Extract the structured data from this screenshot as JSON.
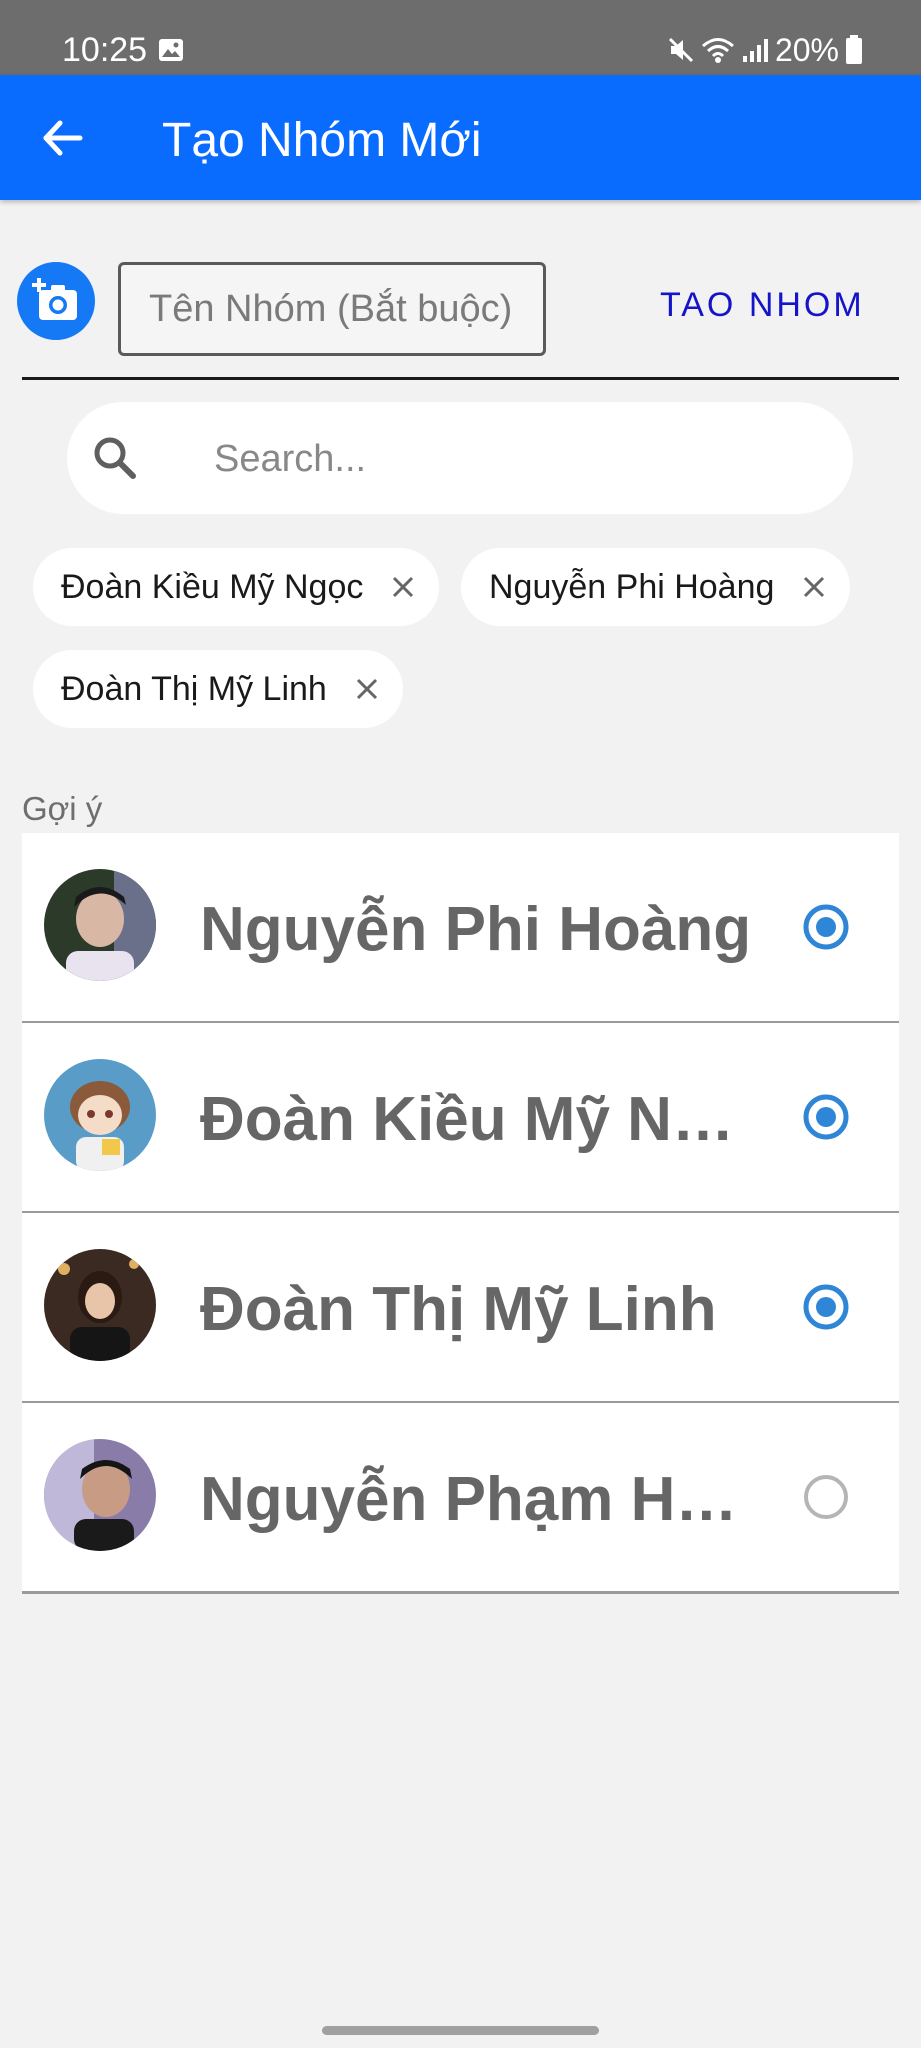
{
  "status_bar": {
    "time": "10:25",
    "battery": "20%"
  },
  "app_bar": {
    "title": "Tạo Nhóm Mới"
  },
  "group_form": {
    "name_placeholder": "Tên Nhóm (Bắt buộc)",
    "name_value": "",
    "create_label": "TAO NHOM"
  },
  "search": {
    "placeholder": "Search..."
  },
  "selected_chips": [
    {
      "label": "Đoàn Kiều Mỹ Ngọc"
    },
    {
      "label": "Nguyễn Phi Hoàng"
    },
    {
      "label": "Đoàn Thị Mỹ Linh"
    }
  ],
  "suggestions": {
    "title": "Gợi ý",
    "items": [
      {
        "name": "Nguyễn Phi Hoàng",
        "selected": true
      },
      {
        "name": "Đoàn Kiều Mỹ Ng...",
        "selected": true
      },
      {
        "name": "Đoàn Thị Mỹ Linh",
        "selected": true
      },
      {
        "name": "Nguyễn Phạm Ho...",
        "selected": false
      }
    ]
  },
  "colors": {
    "primary": "#0a6cff",
    "accent_text": "#1414c9",
    "radio": "#2f86d6",
    "status_bar": "#6d6d6d"
  }
}
